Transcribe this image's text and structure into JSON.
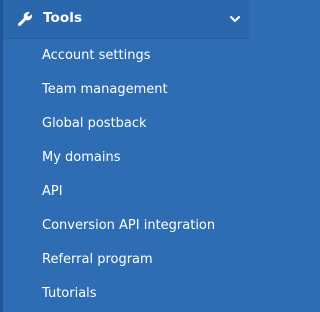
{
  "colors": {
    "panel_background": "#2e6db4",
    "header_background": "#2b67ad",
    "left_border": "#205696",
    "text": "#ffffff"
  },
  "header": {
    "icon": "wrench-icon",
    "title": "Tools",
    "toggle_icon": "chevron-down-icon"
  },
  "items": [
    {
      "label": "Account settings"
    },
    {
      "label": "Team management"
    },
    {
      "label": "Global postback"
    },
    {
      "label": "My domains"
    },
    {
      "label": "API"
    },
    {
      "label": "Conversion API integration"
    },
    {
      "label": "Referral program"
    },
    {
      "label": "Tutorials"
    }
  ]
}
